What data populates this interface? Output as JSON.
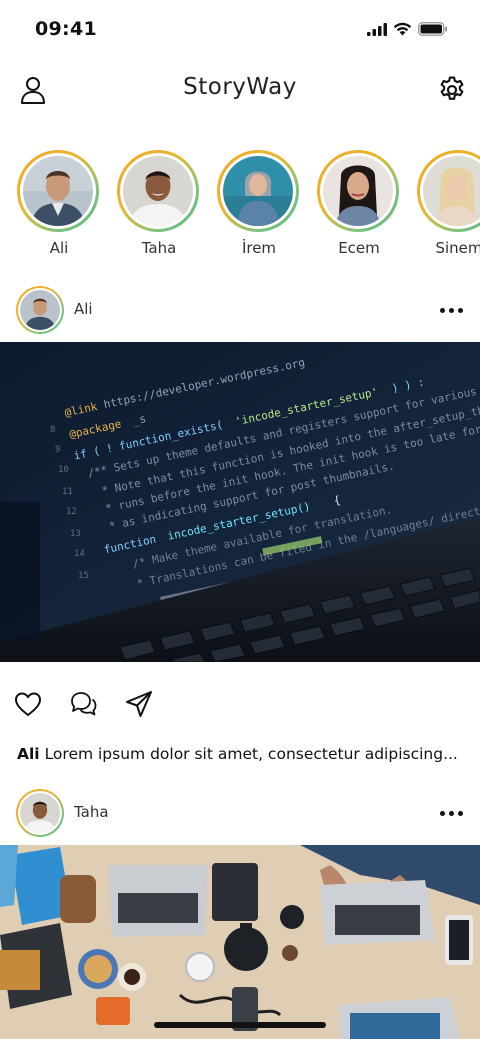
{
  "status_bar": {
    "time": "09:41",
    "icons": [
      "signal-icon",
      "wifi-icon",
      "battery-icon"
    ]
  },
  "header": {
    "title": "StoryWay",
    "left_icon": "profile-icon",
    "right_icon": "gear-icon"
  },
  "stories": [
    {
      "name": "Ali"
    },
    {
      "name": "Taha"
    },
    {
      "name": "İrem"
    },
    {
      "name": "Ecem"
    },
    {
      "name": "Sinem"
    }
  ],
  "posts": [
    {
      "user": "Ali",
      "image": "code-laptop-photo",
      "actions": [
        "heart-icon",
        "comment-icon",
        "send-icon"
      ],
      "caption_user": "Ali",
      "caption_text": "Lorem ipsum dolor sit amet, consectetur adipiscing..."
    },
    {
      "user": "Taha",
      "image": "desk-workspace-photo"
    }
  ],
  "colors": {
    "story_ring_start": "#f5a623",
    "story_ring_end": "#4fb07a",
    "text": "#111111",
    "background": "#ffffff"
  }
}
